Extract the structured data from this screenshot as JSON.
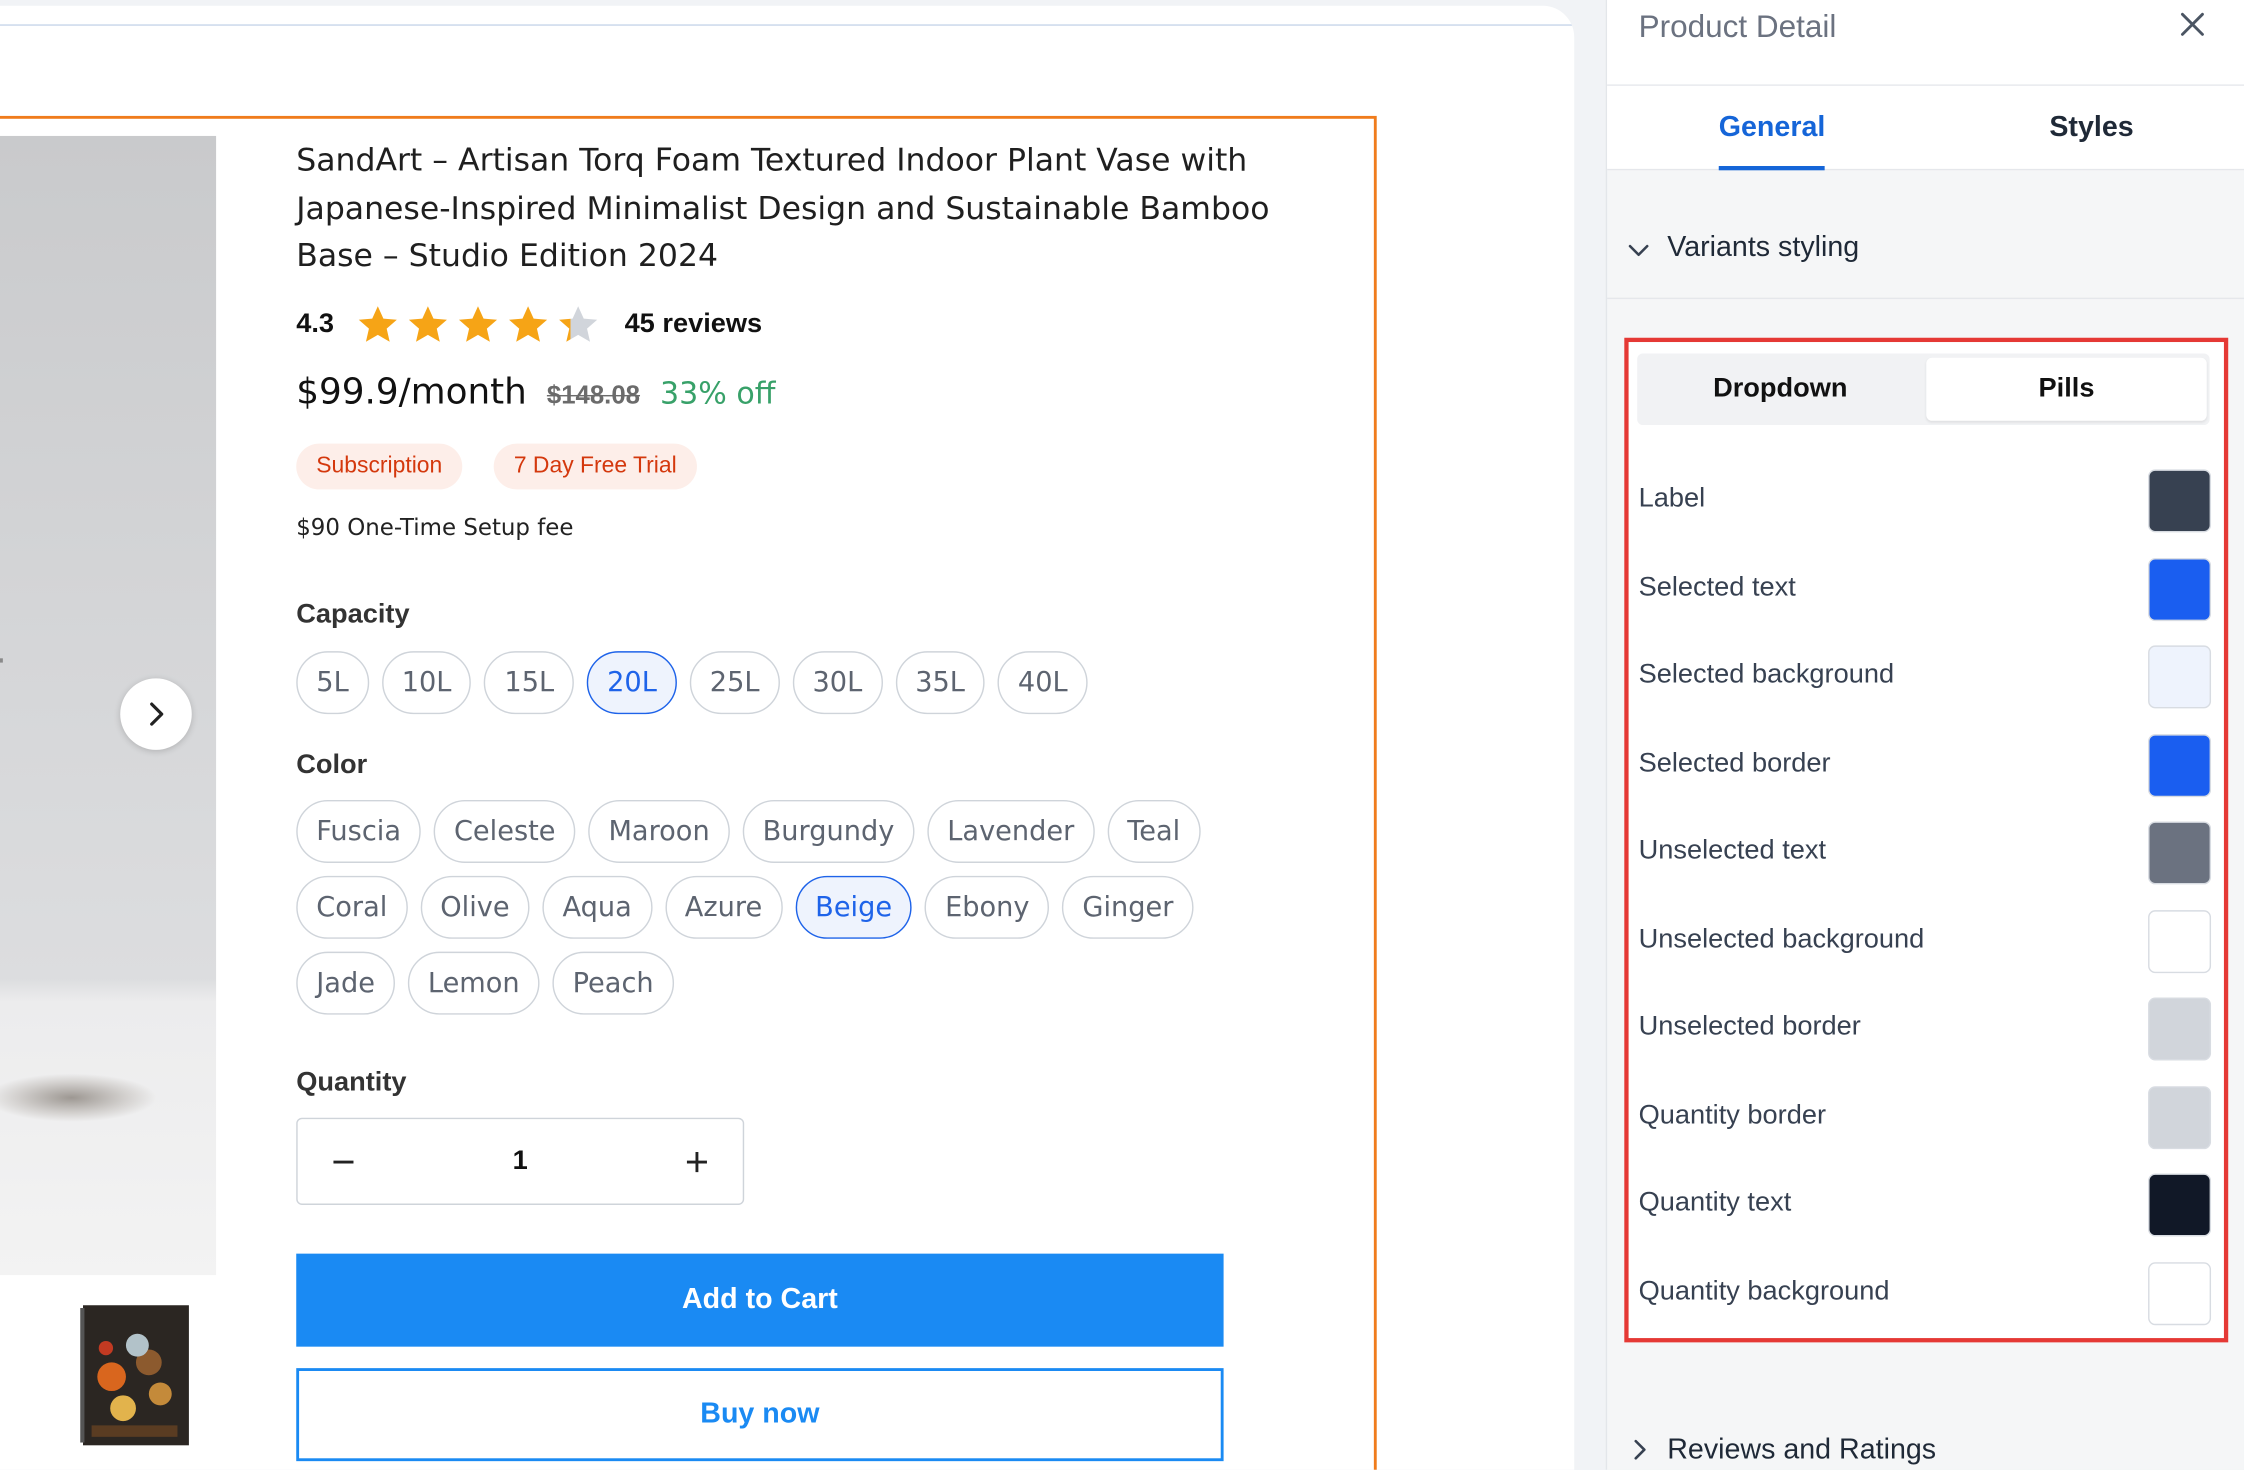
{
  "product": {
    "title": "SandArt – Artisan Torq Foam Textured Indoor Plant Vase with Japanese-Inspired Minimalist Design and Sustainable Bamboo Base – Studio Edition 2024",
    "rating_value": "4.3",
    "rating_stars": 4.3,
    "reviews_label": "45 reviews",
    "price": "$99.9/month",
    "compare_price": "$148.08",
    "discount": "33% off",
    "badges": [
      "Subscription",
      "7 Day Free Trial"
    ],
    "setup_fee": "$90 One-Time Setup fee",
    "capacity": {
      "label": "Capacity",
      "options": [
        "5L",
        "10L",
        "15L",
        "20L",
        "25L",
        "30L",
        "35L",
        "40L"
      ],
      "selected": "20L"
    },
    "color": {
      "label": "Color",
      "options": [
        "Fuscia",
        "Celeste",
        "Maroon",
        "Burgundy",
        "Lavender",
        "Teal",
        "Coral",
        "Olive",
        "Aqua",
        "Azure",
        "Beige",
        "Ebony",
        "Ginger",
        "Jade",
        "Lemon",
        "Peach"
      ],
      "selected": "Beige"
    },
    "quantity": {
      "label": "Quantity",
      "value": "1",
      "decrement_icon": "minus-icon",
      "increment_icon": "plus-icon"
    },
    "add_to_cart": "Add to Cart",
    "buy_now": "Buy now",
    "star_color": "#f6a416",
    "accent": "#1a8af3"
  },
  "panel": {
    "title": "Product Detail",
    "close_icon": "close-icon",
    "tabs": {
      "general": "General",
      "styles": "Styles",
      "active": "General"
    },
    "variants_section": "Variants styling",
    "style_tabs": {
      "dropdown": "Dropdown",
      "pills": "Pills",
      "active": "Pills"
    },
    "color_rows": [
      {
        "label": "Label",
        "color": "#374151"
      },
      {
        "label": "Selected text",
        "color": "#1a5ef0"
      },
      {
        "label": "Selected background",
        "color": "#eef3fd"
      },
      {
        "label": "Selected border",
        "color": "#1a5ef0"
      },
      {
        "label": "Unselected text",
        "color": "#6b7280"
      },
      {
        "label": "Unselected background",
        "color": "#ffffff"
      },
      {
        "label": "Unselected border",
        "color": "#d1d5db"
      },
      {
        "label": "Quantity border",
        "color": "#d1d5db"
      },
      {
        "label": "Quantity text",
        "color": "#111827"
      },
      {
        "label": "Quantity background",
        "color": "#ffffff"
      }
    ],
    "reviews_section": "Reviews and Ratings"
  }
}
